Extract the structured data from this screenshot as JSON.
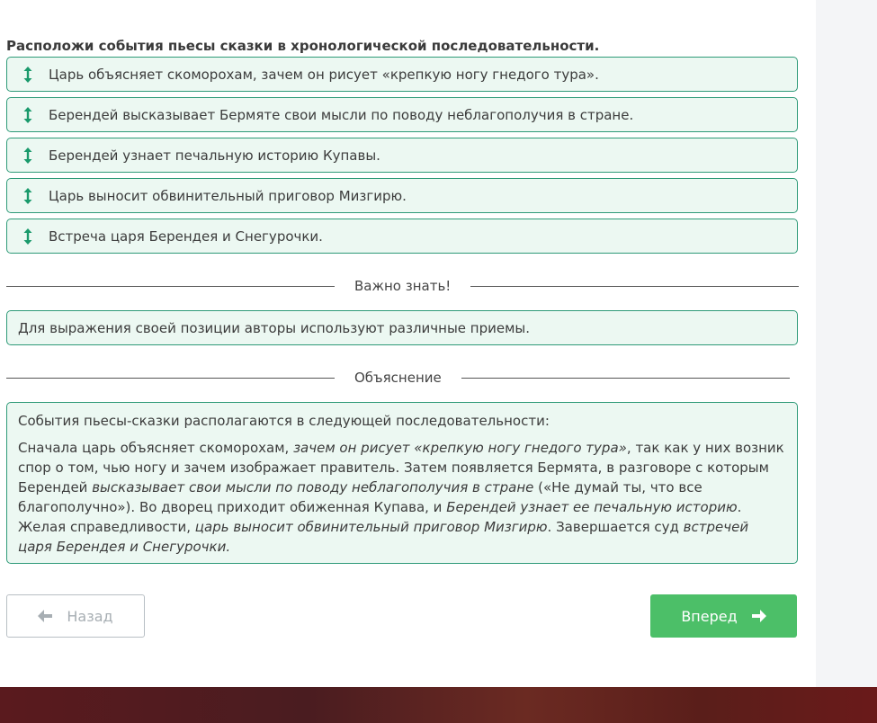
{
  "task": {
    "question": "Расположи события пьесы сказки в хронологической последовательности.",
    "items": [
      {
        "label": "Царь объясняет скоморохам, зачем он рисует «крепкую ногу гнедого тура»."
      },
      {
        "label": "Берендей высказывает Бермяте свои мысли по поводу неблагополучия в стране."
      },
      {
        "label": "Берендей узнает печальную историю Купавы."
      },
      {
        "label": "Царь выносит обвинительный приговор Мизгирю."
      },
      {
        "label": "Встреча царя Берендея и Снегурочки."
      }
    ],
    "drag_icon": "vertical-arrows-icon"
  },
  "important": {
    "heading": "Важно знать!",
    "text": "Для выражения своей позиции авторы используют различные приемы."
  },
  "explanation": {
    "heading": "Объяснение",
    "intro": "События пьесы-сказки располагаются в следующей последовательности:",
    "parts": [
      {
        "t": "Сначала царь объясняет скоморохам, ",
        "i": false
      },
      {
        "t": "зачем он рисует «крепкую ногу гнедого тура»",
        "i": true
      },
      {
        "t": ", так как у них возник спор о том, чью ногу и зачем изображает правитель. Затем появляется Бермята, в разговоре с которым Берендей ",
        "i": false
      },
      {
        "t": "высказывает свои мысли по поводу неблагополучия в стране",
        "i": true
      },
      {
        "t": " («Не думай ты, что все благополучно»). Во дворец приходит обиженная Купава, и ",
        "i": false
      },
      {
        "t": "Берендей узнает ее печальную историю",
        "i": true
      },
      {
        "t": ". Желая справедливости, ",
        "i": false
      },
      {
        "t": "царь выносит обвинительный приговор Мизгирю",
        "i": true
      },
      {
        "t": ". Завершается суд ",
        "i": false
      },
      {
        "t": "встречей царя Берендея и Снегурочки.",
        "i": true
      }
    ]
  },
  "nav": {
    "back_label": "Назад",
    "next_label": "Вперед",
    "back_icon": "arrow-left-icon",
    "next_icon": "arrow-right-icon"
  },
  "colors": {
    "accent_green": "#4cbf68",
    "border_green": "#2e9a78",
    "item_bg": "#ecf8f2"
  }
}
